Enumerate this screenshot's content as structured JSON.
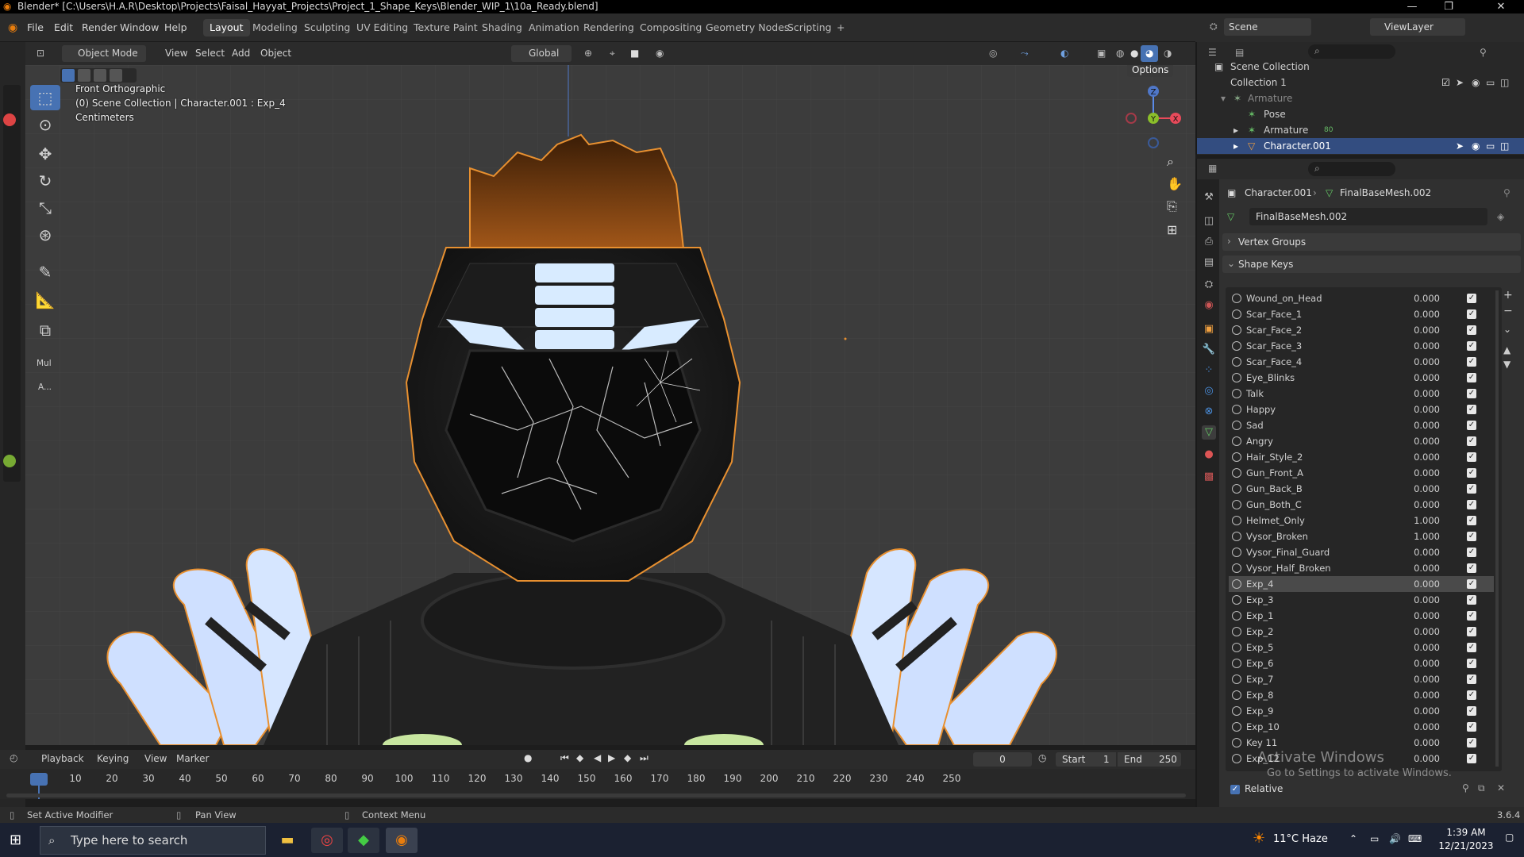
{
  "window": {
    "title": "Blender* [C:\\Users\\H.A.R\\Desktop\\Projects\\Faisal_Hayyat_Projects\\Project_1_Shape_Keys\\Blender_WIP_1\\10a_Ready.blend]",
    "minimize": "—",
    "maximize": "❐",
    "close": "✕"
  },
  "menu": [
    "File",
    "Edit",
    "Render",
    "Window",
    "Help"
  ],
  "workspaces": [
    "Layout",
    "Modeling",
    "Sculpting",
    "UV Editing",
    "Texture Paint",
    "Shading",
    "Animation",
    "Rendering",
    "Compositing",
    "Geometry Nodes",
    "Scripting",
    "+"
  ],
  "scene": {
    "label": "Scene",
    "view_layer": "ViewLayer"
  },
  "viewport_header": {
    "mode": "Object Mode",
    "menus": [
      "View",
      "Select",
      "Add",
      "Object"
    ],
    "transform": "Global",
    "options": "Options"
  },
  "overlay": {
    "view_name": "Front Orthographic",
    "collection": "(0) Scene Collection | Character.001 : Exp_4",
    "units": "Centimeters"
  },
  "toolbar_extra": {
    "mul": "Mul",
    "a": "A..."
  },
  "outliner": {
    "rows": [
      {
        "label": "Scene Collection"
      },
      {
        "label": "Collection 1"
      },
      {
        "label": "Armature"
      },
      {
        "label": "Pose"
      },
      {
        "label": "Armature",
        "badge": "80"
      },
      {
        "label": "Character.001"
      }
    ]
  },
  "properties": {
    "breadcrumb_obj": "Character.001",
    "breadcrumb_mesh": "FinalBaseMesh.002",
    "mesh_name": "FinalBaseMesh.002",
    "vertex_groups": "Vertex Groups",
    "shape_keys_title": "Shape Keys",
    "relative": "Relative"
  },
  "shape_keys": [
    {
      "name": "Wound_on_Head",
      "value": "0.000"
    },
    {
      "name": "Scar_Face_1",
      "value": "0.000"
    },
    {
      "name": "Scar_Face_2",
      "value": "0.000"
    },
    {
      "name": "Scar_Face_3",
      "value": "0.000"
    },
    {
      "name": "Scar_Face_4",
      "value": "0.000"
    },
    {
      "name": "Eye_Blinks",
      "value": "0.000"
    },
    {
      "name": "Talk",
      "value": "0.000"
    },
    {
      "name": "Happy",
      "value": "0.000"
    },
    {
      "name": "Sad",
      "value": "0.000"
    },
    {
      "name": "Angry",
      "value": "0.000"
    },
    {
      "name": "Hair_Style_2",
      "value": "0.000"
    },
    {
      "name": "Gun_Front_A",
      "value": "0.000"
    },
    {
      "name": "Gun_Back_B",
      "value": "0.000"
    },
    {
      "name": "Gun_Both_C",
      "value": "0.000"
    },
    {
      "name": "Helmet_Only",
      "value": "1.000"
    },
    {
      "name": "Vysor_Broken",
      "value": "1.000"
    },
    {
      "name": "Vysor_Final_Guard",
      "value": "0.000"
    },
    {
      "name": "Vysor_Half_Broken",
      "value": "0.000"
    },
    {
      "name": "Exp_4",
      "value": "0.000"
    },
    {
      "name": "Exp_3",
      "value": "0.000"
    },
    {
      "name": "Exp_1",
      "value": "0.000"
    },
    {
      "name": "Exp_2",
      "value": "0.000"
    },
    {
      "name": "Exp_5",
      "value": "0.000"
    },
    {
      "name": "Exp_6",
      "value": "0.000"
    },
    {
      "name": "Exp_7",
      "value": "0.000"
    },
    {
      "name": "Exp_8",
      "value": "0.000"
    },
    {
      "name": "Exp_9",
      "value": "0.000"
    },
    {
      "name": "Exp_10",
      "value": "0.000"
    },
    {
      "name": "Key 11",
      "value": "0.000"
    },
    {
      "name": "Exp_12",
      "value": "0.000"
    }
  ],
  "timeline": {
    "menus": [
      "Playback",
      "Keying",
      "View",
      "Marker"
    ],
    "current_frame": "0",
    "start_label": "Start",
    "start": "1",
    "end_label": "End",
    "end": "250",
    "frames": [
      "0",
      "10",
      "20",
      "30",
      "40",
      "50",
      "60",
      "70",
      "80",
      "90",
      "100",
      "110",
      "120",
      "130",
      "140",
      "150",
      "160",
      "170",
      "180",
      "190",
      "200",
      "210",
      "220",
      "230",
      "240",
      "250"
    ]
  },
  "status": {
    "left": "Set Active Modifier",
    "middle": "Pan View",
    "right": "Context Menu",
    "version": "3.6.4"
  },
  "watermark": {
    "line1": "Activate Windows",
    "line2": "Go to Settings to activate Windows."
  },
  "taskbar": {
    "search_placeholder": "Type here to search",
    "weather": "11°C  Haze",
    "time": "1:39 AM",
    "date": "12/21/2023"
  }
}
